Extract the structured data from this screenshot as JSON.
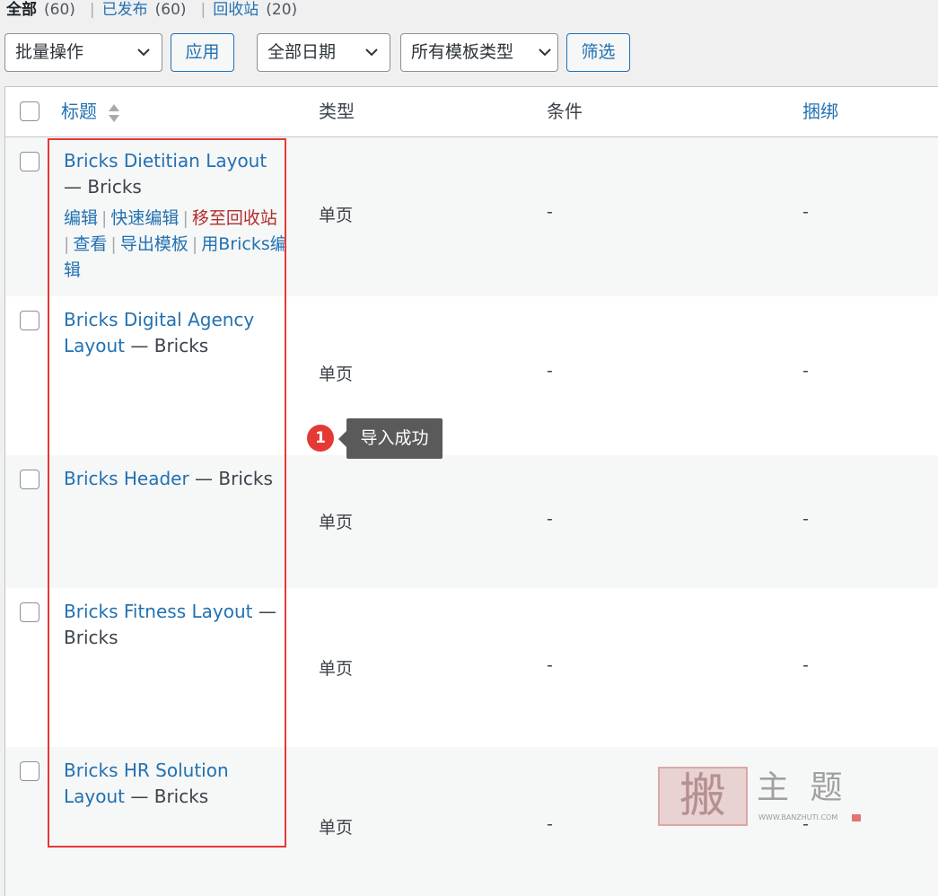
{
  "filters": {
    "all": {
      "label": "全部",
      "count": "(60)"
    },
    "published": {
      "label": "已发布",
      "count": "(60)"
    },
    "trash": {
      "label": "回收站",
      "count": "(20)"
    }
  },
  "toolbar": {
    "bulk_actions": "批量操作",
    "apply": "应用",
    "date_filter": "全部日期",
    "type_filter": "所有模板类型",
    "filter_button": "筛选"
  },
  "table": {
    "columns": {
      "title": "标题",
      "type": "类型",
      "conditions": "条件",
      "bundle": "捆绑"
    },
    "row_actions": {
      "edit": "编辑",
      "quick_edit": "快速编辑",
      "trash": "移至回收站",
      "view": "查看",
      "export": "导出模板",
      "bricks_edit": "用Bricks编辑"
    },
    "rows": [
      {
        "title": "Bricks Dietitian Layout",
        "suffix": "— Bricks",
        "type": "单页",
        "conditions": "-",
        "bundle": "-"
      },
      {
        "title": "Bricks Digital Agency Layout",
        "suffix": "— Bricks",
        "type": "单页",
        "conditions": "-",
        "bundle": "-"
      },
      {
        "title": "Bricks Header",
        "suffix": "— Bricks",
        "type": "单页",
        "conditions": "-",
        "bundle": "-"
      },
      {
        "title": "Bricks Fitness Layout",
        "suffix": "— Bricks",
        "type": "单页",
        "conditions": "-",
        "bundle": "-"
      },
      {
        "title": "Bricks HR Solution Layout",
        "suffix": "— Bricks",
        "type": "单页",
        "conditions": "-",
        "bundle": "-"
      }
    ]
  },
  "annotation": {
    "number": "1",
    "tooltip": "导入成功"
  },
  "watermark": {
    "glyph": "搬",
    "name": "主 题",
    "url": "WWW.BANZHUTI.COM"
  },
  "colors": {
    "link": "#2271b1",
    "trash": "#b32d2e",
    "highlight": "#e53935"
  }
}
